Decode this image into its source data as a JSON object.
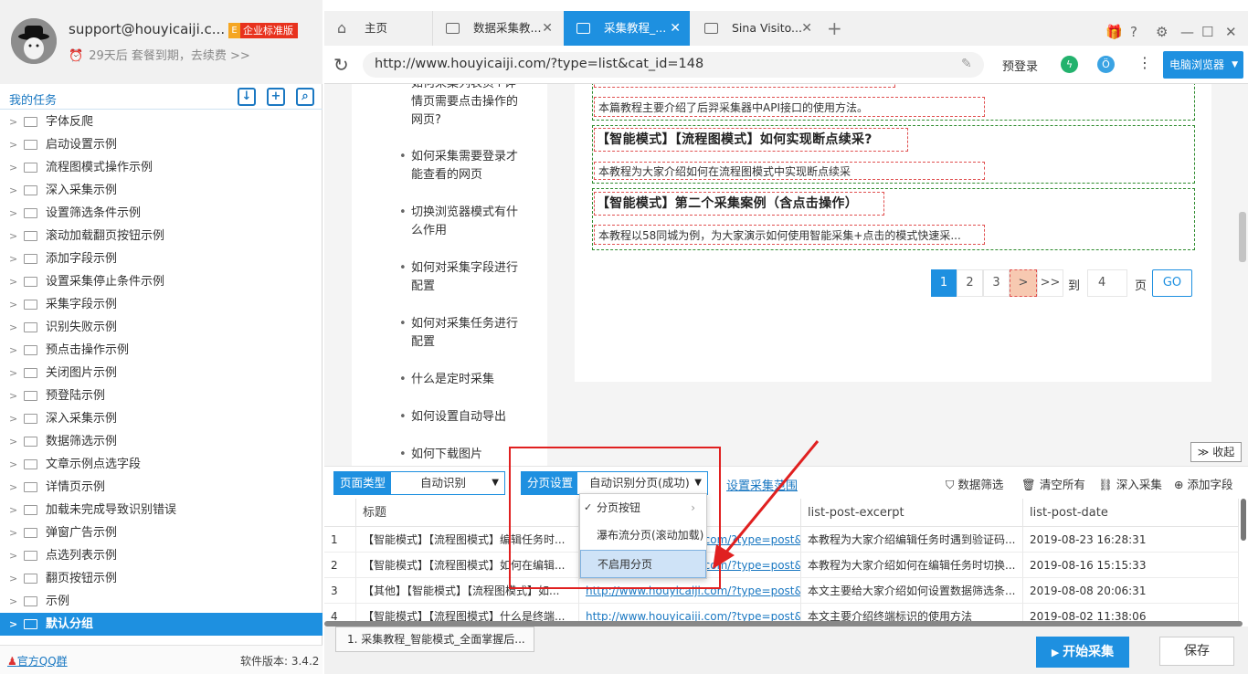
{
  "sidebar": {
    "user_email": "support@houyicaiji.c...",
    "badge_letter": "E",
    "badge_text": "企业标准版",
    "expire_text": "29天后 套餐到期，去续费 >>",
    "my_tasks_title": "我的任务",
    "tree": [
      "字体反爬",
      "启动设置示例",
      "流程图模式操作示例",
      "深入采集示例",
      "设置筛选条件示例",
      "滚动加载翻页按钮示例",
      "添加字段示例",
      "设置采集停止条件示例",
      "采集字段示例",
      "识别失败示例",
      "预点击操作示例",
      "关闭图片示例",
      "预登陆示例",
      "深入采集示例",
      "数据筛选示例",
      "文章示例点选字段",
      "详情页示例",
      "加载未完成导致识别错误",
      "弹窗广告示例",
      "点选列表示例",
      "翻页按钮示例",
      "示例",
      "默认分组"
    ],
    "qq_link": "官方QQ群",
    "version": "软件版本: 3.4.2"
  },
  "tabs": [
    {
      "label": "主页"
    },
    {
      "label": "数据采集教..."
    },
    {
      "label": "采集教程_..."
    },
    {
      "label": "Sina Visito..."
    }
  ],
  "address": {
    "url": "http://www.houyicaiji.com/?type=list&cat_id=148",
    "login": "预登录",
    "browser_mode": "电脑浏览器"
  },
  "web": {
    "side_links": [
      "如何采集列表页+详情页需要点击操作的网页?",
      "如何采集需要登录才能查看的网页",
      "切换浏览器模式有什么作用",
      "如何对采集字段进行配置",
      "如何对采集任务进行配置",
      "什么是定时采集",
      "如何设置自动导出",
      "如何下载图片"
    ],
    "posts": [
      {
        "title": "",
        "excerpt": "本篇教程主要介绍了后羿采集器中API接口的使用方法。"
      },
      {
        "title": "【智能模式】【流程图模式】如何实现断点续采?",
        "excerpt": "本教程为大家介绍如何在流程图模式中实现断点续采"
      },
      {
        "title": "【智能模式】第二个采集案例（含点击操作）",
        "excerpt": "本教程以58同城为例，为大家演示如何使用智能采集+点击的模式快速采..."
      }
    ],
    "pager": {
      "p1": "1",
      "p2": "2",
      "p3": "3",
      "next": ">",
      "last": ">>",
      "goto": "到",
      "page_input": "4",
      "page_unit": "页",
      "go": "GO"
    },
    "collapse": "收起"
  },
  "toolbar": {
    "page_type_label": "页面类型",
    "page_type_value": "自动识别",
    "paging_label": "分页设置",
    "paging_value": "自动识别分页(成功)",
    "range_link": "设置采集范围",
    "filter": "数据筛选",
    "clear": "清空所有",
    "deep": "深入采集",
    "add_field": "添加字段"
  },
  "dropdown": {
    "items": [
      "分页按钮",
      "瀑布流分页(滚动加载)",
      "不启用分页"
    ]
  },
  "table": {
    "headers": [
      "标题",
      "",
      "list-post-excerpt",
      "list-post-date"
    ],
    "rows": [
      {
        "n": "1",
        "title": "【智能模式】【流程图模式】编辑任务时...",
        "link": "http://www.houyicaiji.com/?type=post&pi...",
        "excerpt": "本教程为大家介绍编辑任务时遇到验证码...",
        "date": "2019-08-23 16:28:31"
      },
      {
        "n": "2",
        "title": "【智能模式】【流程图模式】如何在编辑...",
        "link": "http://www.houyicaiji.com/?type=post&pi...",
        "excerpt": "本教程为大家介绍如何在编辑任务时切换...",
        "date": "2019-08-16 15:15:33"
      },
      {
        "n": "3",
        "title": "【其他】【智能模式】【流程图模式】如...",
        "link": "http://www.houyicaiji.com/?type=post&pi...",
        "excerpt": "本文主要给大家介绍如何设置数据筛选条...",
        "date": "2019-08-08 20:06:31"
      },
      {
        "n": "4",
        "title": "【智能模式】【流程图模式】什么是终端...",
        "link": "http://www.houyicaiji.com/?type=post&pi...",
        "excerpt": "本文主要介绍终端标识的使用方法",
        "date": "2019-08-02 11:38:06"
      }
    ]
  },
  "bottom": {
    "task_tab": "1. 采集教程_智能模式_全面掌握后...",
    "start": "开始采集",
    "save": "保存"
  },
  "colors": {
    "accent": "#1e90e0",
    "highlight_red": "#e02020"
  }
}
